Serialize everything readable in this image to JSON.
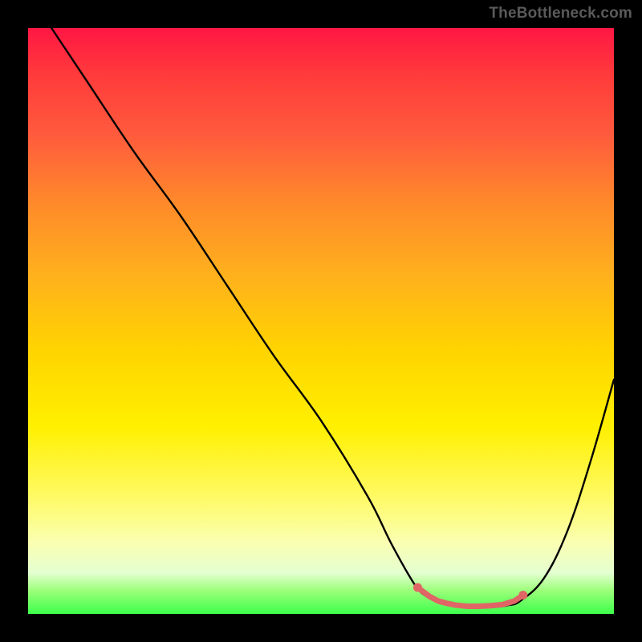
{
  "watermark": "TheBottleneck.com",
  "colors": {
    "frame": "#000000",
    "curve": "#000000",
    "marker": "#e06666",
    "marker_stroke": "#e06666"
  },
  "chart_data": {
    "type": "line",
    "title": "",
    "xlabel": "",
    "ylabel": "",
    "x_range": [
      0,
      100
    ],
    "y_range": [
      0,
      100
    ],
    "background": "vertical_gradient_red_to_green",
    "series": [
      {
        "name": "bottleneck-curve",
        "x": [
          4,
          10,
          18,
          26,
          34,
          42,
          50,
          58,
          62,
          66,
          68,
          70,
          72,
          74,
          76,
          78,
          80,
          82,
          84,
          88,
          92,
          96,
          100
        ],
        "y": [
          100,
          91,
          79,
          68,
          56,
          44,
          33,
          20,
          12,
          5,
          3,
          2,
          1.5,
          1.2,
          1.1,
          1.1,
          1.2,
          1.5,
          2.2,
          6,
          14,
          26,
          40
        ]
      }
    ],
    "highlight": {
      "name": "optimal-range-markers",
      "x": [
        66.5,
        68.5,
        70.0,
        71.5,
        73.0,
        75.0,
        77.0,
        79.0,
        81.0,
        83.0,
        84.5
      ],
      "y": [
        4.5,
        3.0,
        2.2,
        1.8,
        1.5,
        1.3,
        1.3,
        1.4,
        1.6,
        2.2,
        3.2
      ]
    }
  }
}
